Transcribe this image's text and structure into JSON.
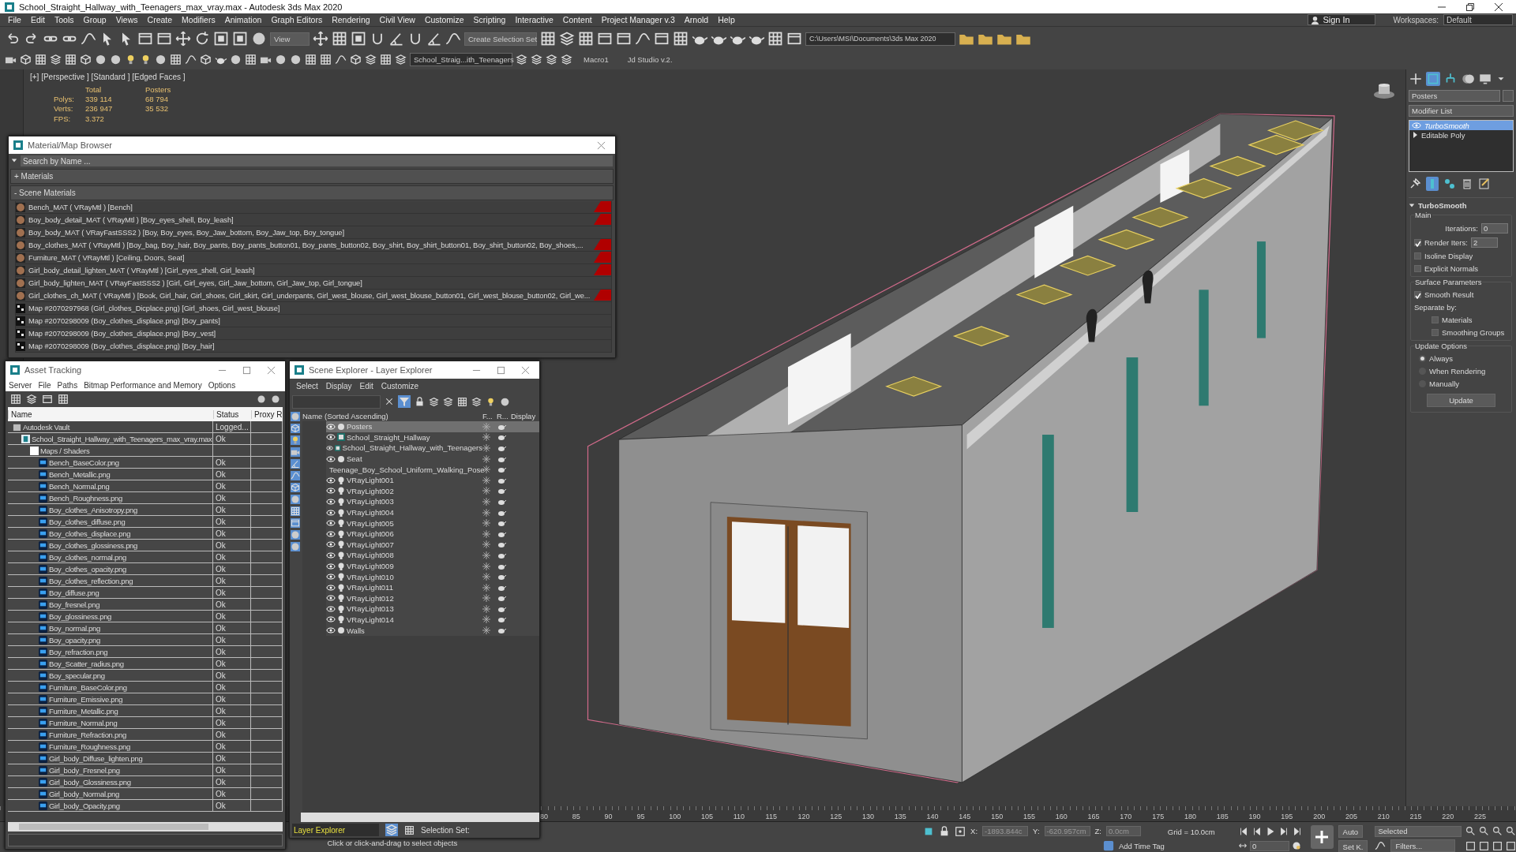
{
  "window": {
    "title": "School_Straight_Hallway_with_Teenagers_max_vray.max - Autodesk 3ds Max 2020"
  },
  "menu_bar": {
    "items": [
      "File",
      "Edit",
      "Tools",
      "Group",
      "Views",
      "Create",
      "Modifiers",
      "Animation",
      "Graph Editors",
      "Rendering",
      "Civil View",
      "Customize",
      "Scripting",
      "Interactive",
      "Content",
      "Project Manager v.3",
      "Arnold",
      "Help"
    ],
    "sign_in": "Sign In",
    "workspaces_label": "Workspaces:",
    "workspace": "Default"
  },
  "toolbar": {
    "view_dropdown": "View",
    "selection_set_dropdown": "Create Selection Set",
    "project_path": "C:\\Users\\MSI\\Documents\\3ds Max 2020",
    "scene_dropdown": "School_Straig...ith_Teenagers",
    "macro_buttons": [
      "Macro1",
      "Jd Studio v.2."
    ]
  },
  "viewport": {
    "label": "[+] [Perspective ] [Standard ] [Edged Faces ]",
    "stats_columns": [
      "Total",
      "Posters"
    ],
    "stats_rows": [
      {
        "label": "Polys:",
        "values": [
          "339 114",
          "68 794"
        ]
      },
      {
        "label": "Verts:",
        "values": [
          "236 947",
          "35 532"
        ]
      }
    ],
    "fps_label": "FPS:",
    "fps": "3.372"
  },
  "material_browser": {
    "title": "Material/Map Browser",
    "search_placeholder": "Search by Name ...",
    "groups": [
      "+ Materials",
      "- Scene Materials"
    ],
    "items": [
      {
        "text": "Bench_MAT ( VRayMtl ) [Bench]",
        "kind": "material",
        "marked": true
      },
      {
        "text": "Boy_body_detail_MAT ( VRayMtl ) [Boy_eyes_shell, Boy_leash]",
        "kind": "material",
        "marked": true
      },
      {
        "text": "Boy_body_MAT ( VRayFastSSS2 ) [Boy, Boy_eyes, Boy_Jaw_bottom, Boy_Jaw_top, Boy_tongue]",
        "kind": "material",
        "marked": false
      },
      {
        "text": "Boy_clothes_MAT ( VRayMtl ) [Boy_bag, Boy_hair, Boy_pants, Boy_pants_button01, Boy_pants_button02, Boy_shirt, Boy_shirt_button01, Boy_shirt_button02, Boy_shoes,...",
        "kind": "material",
        "marked": true
      },
      {
        "text": "Furniture_MAT ( VRayMtl ) [Ceiling, Doors, Seat]",
        "kind": "material",
        "marked": true
      },
      {
        "text": "Girl_body_detail_lighten_MAT ( VRayMtl ) [Girl_eyes_shell, Girl_leash]",
        "kind": "material",
        "marked": true
      },
      {
        "text": "Girl_body_lighten_MAT ( VRayFastSSS2 ) [Girl, Girl_eyes, Girl_Jaw_bottom, Girl_Jaw_top, Girl_tongue]",
        "kind": "material",
        "marked": false
      },
      {
        "text": "Girl_clothes_ch_MAT ( VRayMtl ) [Book, Girl_hair, Girl_shoes, Girl_skirt, Girl_underpants, Girl_west_blouse, Girl_west_blouse_button01, Girl_west_blouse_button02, Girl_we...",
        "kind": "material",
        "marked": true
      },
      {
        "text": "Map #2070297968 (Girl_clothes_Dicplace.png) [Girl_shoes, Girl_west_blouse]",
        "kind": "map",
        "marked": false
      },
      {
        "text": "Map #2070298009 (Boy_clothes_displace.png) [Boy_pants]",
        "kind": "map",
        "marked": false
      },
      {
        "text": "Map #2070298009 (Boy_clothes_displace.png) [Boy_vest]",
        "kind": "map",
        "marked": false
      },
      {
        "text": "Map #2070298009 (Boy_clothes_displace.png) [Boy_hair]",
        "kind": "map",
        "marked": false
      }
    ]
  },
  "asset_tracking": {
    "title": "Asset Tracking",
    "menu": [
      "Server",
      "File",
      "Paths",
      "Bitmap Performance and Memory",
      "Options"
    ],
    "columns": [
      "Name",
      "Status",
      "Proxy R"
    ],
    "tree": [
      {
        "name": "Autodesk Vault",
        "kind": "vault",
        "status": "Logged...",
        "children": [
          {
            "name": "School_Straight_Hallway_with_Teenagers_max_vray.max",
            "kind": "scene",
            "status": "Ok",
            "children": [
              {
                "name": "Maps / Shaders",
                "kind": "folder",
                "children": [
                  {
                    "name": "Bench_BaseColor.png",
                    "kind": "bitmap",
                    "status": "Ok"
                  },
                  {
                    "name": "Bench_Metallic.png",
                    "kind": "bitmap",
                    "status": "Ok"
                  },
                  {
                    "name": "Bench_Normal.png",
                    "kind": "bitmap",
                    "status": "Ok"
                  },
                  {
                    "name": "Bench_Roughness.png",
                    "kind": "bitmap",
                    "status": "Ok"
                  },
                  {
                    "name": "Boy_clothes_Anisotropy.png",
                    "kind": "bitmap",
                    "status": "Ok"
                  },
                  {
                    "name": "Boy_clothes_diffuse.png",
                    "kind": "bitmap",
                    "status": "Ok"
                  },
                  {
                    "name": "Boy_clothes_displace.png",
                    "kind": "bitmap",
                    "status": "Ok"
                  },
                  {
                    "name": "Boy_clothes_glossiness.png",
                    "kind": "bitmap",
                    "status": "Ok"
                  },
                  {
                    "name": "Boy_clothes_normal.png",
                    "kind": "bitmap",
                    "status": "Ok"
                  },
                  {
                    "name": "Boy_clothes_opacity.png",
                    "kind": "bitmap",
                    "status": "Ok"
                  },
                  {
                    "name": "Boy_clothes_reflection.png",
                    "kind": "bitmap",
                    "status": "Ok"
                  },
                  {
                    "name": "Boy_diffuse.png",
                    "kind": "bitmap",
                    "status": "Ok"
                  },
                  {
                    "name": "Boy_fresnel.png",
                    "kind": "bitmap",
                    "status": "Ok"
                  },
                  {
                    "name": "Boy_glossiness.png",
                    "kind": "bitmap",
                    "status": "Ok"
                  },
                  {
                    "name": "Boy_normal.png",
                    "kind": "bitmap",
                    "status": "Ok"
                  },
                  {
                    "name": "Boy_opacity.png",
                    "kind": "bitmap",
                    "status": "Ok"
                  },
                  {
                    "name": "Boy_refraction.png",
                    "kind": "bitmap",
                    "status": "Ok"
                  },
                  {
                    "name": "Boy_Scatter_radius.png",
                    "kind": "bitmap",
                    "status": "Ok"
                  },
                  {
                    "name": "Boy_specular.png",
                    "kind": "bitmap",
                    "status": "Ok"
                  },
                  {
                    "name": "Furniture_BaseColor.png",
                    "kind": "bitmap",
                    "status": "Ok"
                  },
                  {
                    "name": "Furniture_Emissive.png",
                    "kind": "bitmap",
                    "status": "Ok"
                  },
                  {
                    "name": "Furniture_Metallic.png",
                    "kind": "bitmap",
                    "status": "Ok"
                  },
                  {
                    "name": "Furniture_Normal.png",
                    "kind": "bitmap",
                    "status": "Ok"
                  },
                  {
                    "name": "Furniture_Refraction.png",
                    "kind": "bitmap",
                    "status": "Ok"
                  },
                  {
                    "name": "Furniture_Roughness.png",
                    "kind": "bitmap",
                    "status": "Ok"
                  },
                  {
                    "name": "Girl_body_Diffuse_lighten.png",
                    "kind": "bitmap",
                    "status": "Ok"
                  },
                  {
                    "name": "Girl_body_Fresnel.png",
                    "kind": "bitmap",
                    "status": "Ok"
                  },
                  {
                    "name": "Girl_body_Glossiness.png",
                    "kind": "bitmap",
                    "status": "Ok"
                  },
                  {
                    "name": "Girl_body_Normal.png",
                    "kind": "bitmap",
                    "status": "Ok"
                  },
                  {
                    "name": "Girl_body_Opacity.png",
                    "kind": "bitmap",
                    "status": "Ok"
                  }
                ]
              }
            ]
          }
        ]
      }
    ]
  },
  "scene_explorer": {
    "title": "Scene Explorer - Layer Explorer",
    "menu": [
      "Select",
      "Display",
      "Edit",
      "Customize"
    ],
    "columns": [
      "Name (Sorted Ascending)",
      "F...",
      "R...",
      "Display"
    ],
    "rows": [
      {
        "name": "Posters",
        "kind": "layer",
        "selected": true
      },
      {
        "name": "School_Straight_Hallway",
        "kind": "group",
        "selected": false
      },
      {
        "name": "School_Straight_Hallway_with_Teenagers",
        "kind": "group",
        "selected": false
      },
      {
        "name": "Seat",
        "kind": "layer",
        "selected": false
      },
      {
        "name": "Teenage_Boy_School_Uniform_Walking_Pose",
        "kind": "group",
        "selected": false
      },
      {
        "name": "VRayLight001",
        "kind": "light",
        "selected": false
      },
      {
        "name": "VRayLight002",
        "kind": "light",
        "selected": false
      },
      {
        "name": "VRayLight003",
        "kind": "light",
        "selected": false
      },
      {
        "name": "VRayLight004",
        "kind": "light",
        "selected": false
      },
      {
        "name": "VRayLight005",
        "kind": "light",
        "selected": false
      },
      {
        "name": "VRayLight006",
        "kind": "light",
        "selected": false
      },
      {
        "name": "VRayLight007",
        "kind": "light",
        "selected": false
      },
      {
        "name": "VRayLight008",
        "kind": "light",
        "selected": false
      },
      {
        "name": "VRayLight009",
        "kind": "light",
        "selected": false
      },
      {
        "name": "VRayLight010",
        "kind": "light",
        "selected": false
      },
      {
        "name": "VRayLight011",
        "kind": "light",
        "selected": false
      },
      {
        "name": "VRayLight012",
        "kind": "light",
        "selected": false
      },
      {
        "name": "VRayLight013",
        "kind": "light",
        "selected": false
      },
      {
        "name": "VRayLight014",
        "kind": "light",
        "selected": false
      },
      {
        "name": "Walls",
        "kind": "layer",
        "selected": false
      }
    ],
    "explorer_dropdown": "Layer Explorer",
    "selection_set_label": "Selection Set:"
  },
  "command_panel": {
    "object_name": "Posters",
    "modifier_list": "Modifier List",
    "stack": [
      {
        "label": "TurboSmooth",
        "kind": "modifier",
        "selected": true
      },
      {
        "label": "Editable Poly",
        "kind": "base",
        "selected": false
      }
    ]
  },
  "turbosmooth": {
    "title": "TurboSmooth",
    "main_label": "Main",
    "iterations_label": "Iterations:",
    "iterations": "0",
    "render_iters": {
      "label": "Render Iters:",
      "value": "2",
      "checked": true
    },
    "isoline_display": {
      "label": "Isoline Display",
      "checked": false
    },
    "explicit_normals": {
      "label": "Explicit Normals",
      "checked": false
    },
    "surface_label": "Surface Parameters",
    "smooth_result": {
      "label": "Smooth Result",
      "checked": true
    },
    "separate_by": "Separate by:",
    "separate_options": [
      {
        "label": "Materials",
        "checked": false
      },
      {
        "label": "Smoothing Groups",
        "checked": false
      }
    ],
    "update_label": "Update Options",
    "update_options": [
      {
        "label": "Always",
        "selected": true
      },
      {
        "label": "When Rendering",
        "selected": false
      },
      {
        "label": "Manually",
        "selected": false
      }
    ],
    "update_button": "Update"
  },
  "timeline": {
    "ticks": [
      "80",
      "85",
      "90",
      "95",
      "100",
      "105",
      "110",
      "115",
      "120",
      "125",
      "130",
      "135",
      "140",
      "145",
      "150",
      "155",
      "160",
      "165",
      "170",
      "175",
      "180",
      "185",
      "190",
      "195",
      "200",
      "205",
      "210",
      "215",
      "220",
      "225"
    ]
  },
  "status_bar": {
    "prompt": "Click or click-and-drag to select objects",
    "x_label": "X:",
    "x": "-1893.844c",
    "y_label": "Y:",
    "y": "-620.957cm",
    "z_label": "Z:",
    "z": "0.0cm",
    "grid": "Grid = 10.0cm",
    "add_time_tag": "Add Time Tag",
    "frame": "0",
    "auto": "Auto",
    "set_key": "Set K.",
    "key_filter": "Selected",
    "filters": "Filters..."
  }
}
